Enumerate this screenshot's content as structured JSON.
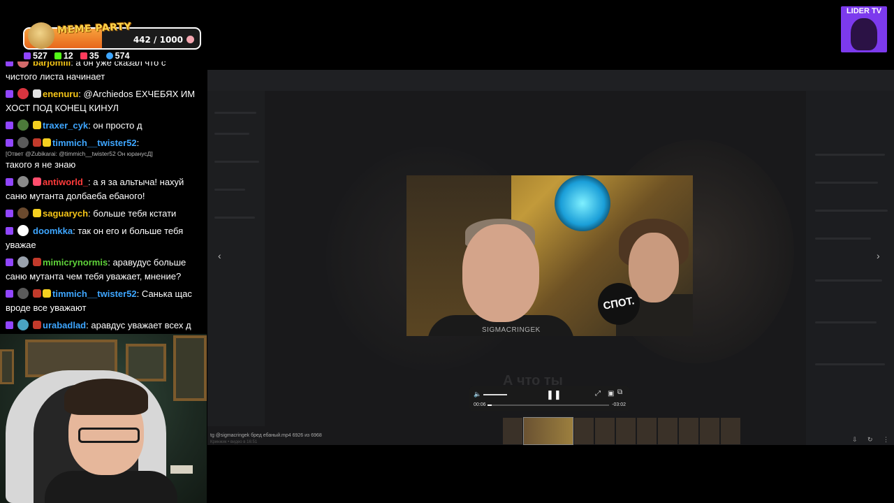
{
  "overlay": {
    "meme_title": "MEME PARTY",
    "meme_progress_label": "442 / 1000",
    "meme_progress_fraction": 0.442,
    "stats": [
      {
        "icon": "twitch-icon",
        "value": "527",
        "color": "#9146ff"
      },
      {
        "icon": "kick-icon",
        "value": "12",
        "color": "#53fc18"
      },
      {
        "icon": "vk-live-icon",
        "value": "35",
        "color": "#ff3b5c"
      },
      {
        "icon": "viewers-icon",
        "value": "574",
        "color": "#3ea6ff"
      }
    ]
  },
  "logo": {
    "text": "LIDER TV"
  },
  "chat": {
    "messages": [
      {
        "user": "barjomiii",
        "color": "#f5c518",
        "text": "а он уже сказал что с",
        "avatar": "#d36a6a"
      },
      {
        "user": "",
        "color": "#ffffff",
        "text": "чистого листа начинает",
        "avatar": ""
      },
      {
        "user": "enenuru",
        "color": "#f5c518",
        "text": "@Archiedos ЕХЧЕБЯХ ИМ ХОСТ ПОД КОНЕЦ КИНУЛ",
        "avatar": "#d9343f"
      },
      {
        "user": "traxer_cyk",
        "color": "#3ea6ff",
        "text": "он просто д",
        "avatar": "#4c7a3a"
      },
      {
        "user": "timmich__twister52",
        "color": "#3ea6ff",
        "text": "",
        "avatar": "#5a5a5a"
      },
      {
        "user": "antiworld_",
        "color": "#ff3b3b",
        "text": "а я за альтыча! нахуй саню мутанта долбаеба ебаного!",
        "avatar": "#8a8a8a"
      },
      {
        "user": "saguarych",
        "color": "#f5c518",
        "text": "больше тебя кстати",
        "avatar": "#6b4a2e"
      },
      {
        "user": "doomkka",
        "color": "#3ea6ff",
        "text": "так он его и больше тебя уважае",
        "avatar": "#ffffff"
      },
      {
        "user": "mimicrynormis",
        "color": "#5fd33a",
        "text": "аравудус больше саню мутанта чем тебя уважает, мнение?",
        "avatar": "#9aa2ad"
      },
      {
        "user": "timmich__twister52",
        "color": "#3ea6ff",
        "text": "Санька щас вроде все уважают",
        "avatar": "#5a5a5a"
      },
      {
        "user": "urabadlad",
        "color": "#3ea6ff",
        "text": "аравдус уважает всех д",
        "avatar": "#4aa3c2"
      }
    ],
    "reply_note": "[Ответ @Zubikarai: @timmich__twister52 Он юранусД]",
    "reply_text": "такого я не знаю"
  },
  "player": {
    "current_time": "00:06",
    "total_time": "-03:02",
    "progress_fraction": 0.033,
    "volume_fraction": 1.0
  },
  "video": {
    "watermark": "SIGMACRINGEK",
    "sign_text": "СПОТ.",
    "subtitle_ghost": "А что ты"
  },
  "media_caption": {
    "file_line": "tg @sigmacringek бред ебаный.mp4 6926 из 6968",
    "meta_line": "Кринжик • видео в 16:51"
  },
  "thumbnails_count": 10
}
